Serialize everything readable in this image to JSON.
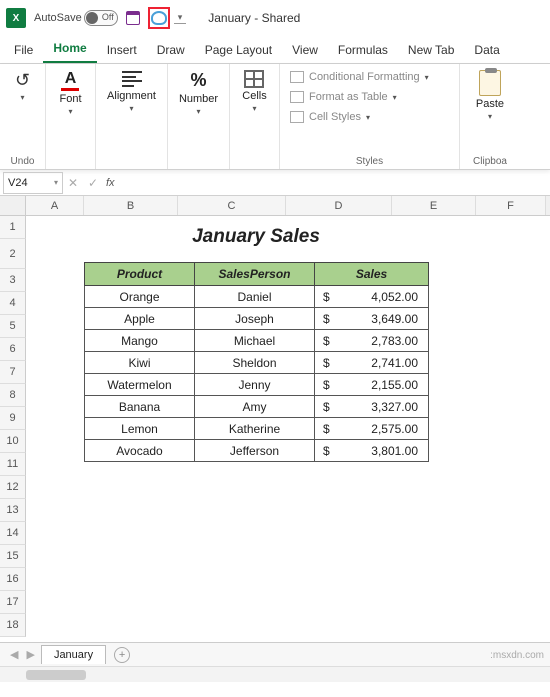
{
  "titlebar": {
    "autosave": "AutoSave",
    "toggle_state": "Off",
    "doc_title": "January - Shared"
  },
  "tabs": [
    "File",
    "Home",
    "Insert",
    "Draw",
    "Page Layout",
    "View",
    "Formulas",
    "New Tab",
    "Data"
  ],
  "active_tab": "Home",
  "ribbon": {
    "undo": "Undo",
    "font": "Font",
    "alignment": "Alignment",
    "number": "Number",
    "cells": "Cells",
    "cond": "Conditional Formatting",
    "fmttbl": "Format as Table",
    "cellstyles": "Cell Styles",
    "styles": "Styles",
    "paste": "Paste",
    "clipboard": "Clipboa"
  },
  "formula_bar": {
    "name": "V24",
    "fx": "fx"
  },
  "columns": [
    "A",
    "B",
    "C",
    "D",
    "E",
    "F"
  ],
  "rows": [
    "1",
    "2",
    "3",
    "4",
    "5",
    "6",
    "7",
    "8",
    "9",
    "10",
    "11",
    "12",
    "13",
    "14",
    "15",
    "16",
    "17",
    "18"
  ],
  "sales": {
    "title": "January Sales",
    "headers": [
      "Product",
      "SalesPerson",
      "Sales"
    ],
    "rows": [
      {
        "product": "Orange",
        "person": "Daniel",
        "value": "4,052.00"
      },
      {
        "product": "Apple",
        "person": "Joseph",
        "value": "3,649.00"
      },
      {
        "product": "Mango",
        "person": "Michael",
        "value": "2,783.00"
      },
      {
        "product": "Kiwi",
        "person": "Sheldon",
        "value": "2,741.00"
      },
      {
        "product": "Watermelon",
        "person": "Jenny",
        "value": "2,155.00"
      },
      {
        "product": "Banana",
        "person": "Amy",
        "value": "3,327.00"
      },
      {
        "product": "Lemon",
        "person": "Katherine",
        "value": "2,575.00"
      },
      {
        "product": "Avocado",
        "person": "Jefferson",
        "value": "3,801.00"
      }
    ]
  },
  "sheet_tab": "January",
  "watermark": ":msxdn.com"
}
